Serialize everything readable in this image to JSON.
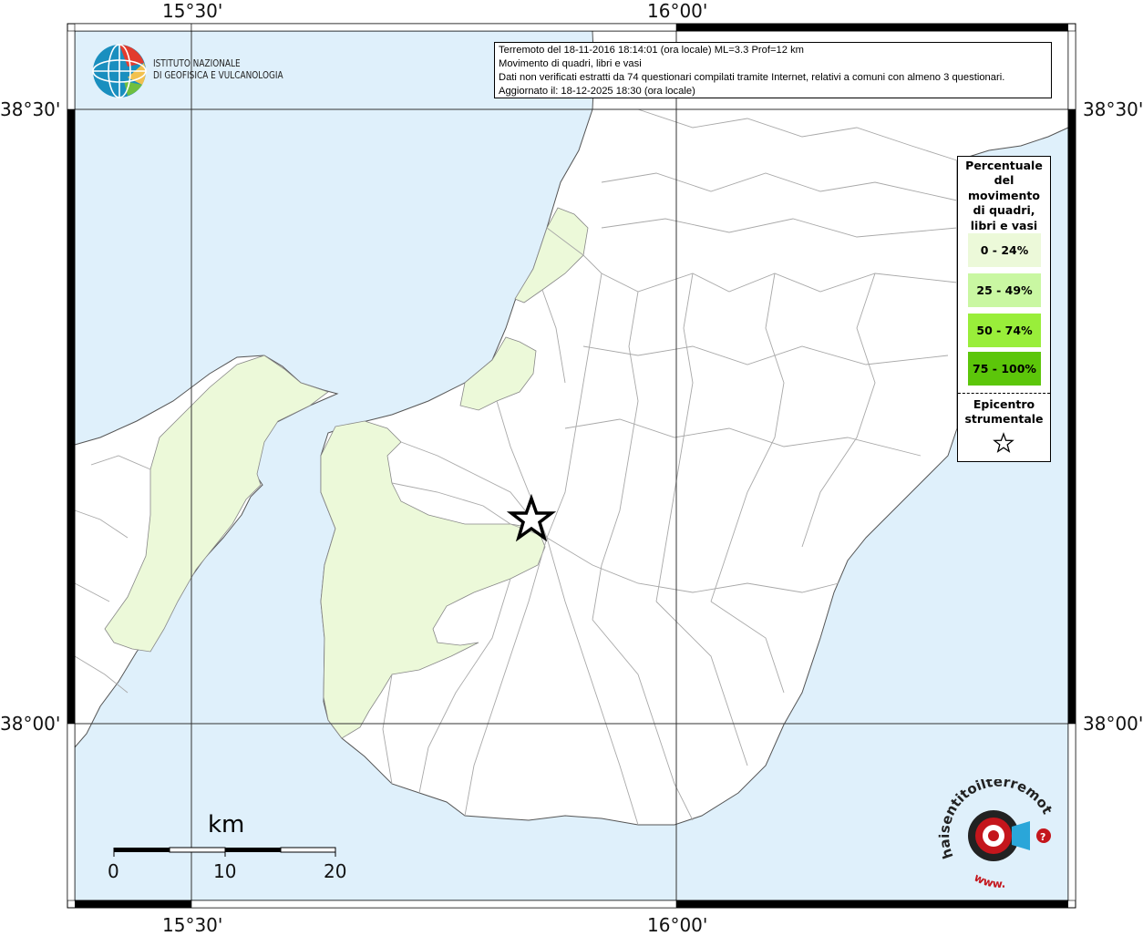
{
  "map": {
    "sea_color": "#dff0fb",
    "land_color": "#ffffff",
    "affected_color": "#ecf9d9",
    "border_color": "#999999"
  },
  "coords": {
    "lon_labels": [
      "15°30'",
      "16°00'"
    ],
    "lat_labels": [
      "38°30'",
      "38°00'"
    ]
  },
  "header": {
    "org_line1": "ISTITUTO NAZIONALE",
    "org_line2": "DI GEOFISICA E VULCANOLOGIA"
  },
  "info": {
    "line1": "Terremoto del 18-11-2016 18:14:01 (ora locale) ML=3.3 Prof=12 km",
    "line2": "Movimento di quadri, libri e vasi",
    "line3": "Dati non verificati estratti da 74 questionari compilati tramite Internet, relativi a comuni con almeno 3 questionari.",
    "line4": "Aggiornato il: 18-12-2025 18:30 (ora locale)"
  },
  "legend": {
    "title": "Percentuale del movimento di quadri, libri e vasi",
    "classes": [
      {
        "label": "0 - 24%",
        "color": "#ecf9d9"
      },
      {
        "label": "25 - 49%",
        "color": "#c9f7a2"
      },
      {
        "label": "50 - 74%",
        "color": "#99ee3a"
      },
      {
        "label": "75 - 100%",
        "color": "#5cc60a"
      }
    ],
    "epicenter_label": "Epicentro strumentale"
  },
  "scalebar": {
    "unit": "km",
    "ticks": [
      "0",
      "10",
      "20"
    ]
  },
  "logo": {
    "brand": "haisentitoilterremoto.it",
    "prefix": "www."
  }
}
